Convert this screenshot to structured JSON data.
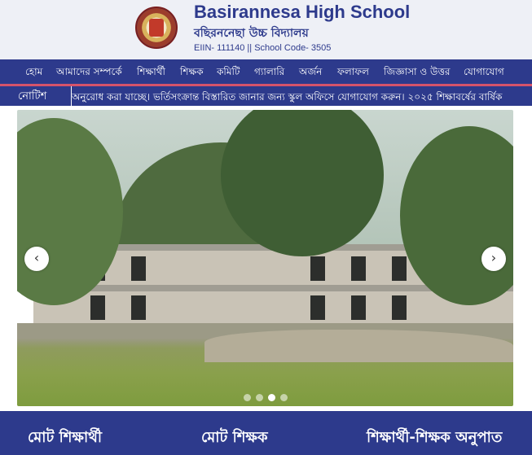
{
  "header": {
    "school_name_en": "Basirannesa High School",
    "school_name_bn": "বছিরননেছা উচ্চ বিদ্যালয়",
    "codes": "EIIN- 111140 || School Code- 3505"
  },
  "nav": {
    "items": [
      {
        "label": "হোম"
      },
      {
        "label": "আমাদের সম্পর্কে"
      },
      {
        "label": "শিক্ষার্থী"
      },
      {
        "label": "শিক্ষক"
      },
      {
        "label": "কমিটি"
      },
      {
        "label": "গ্যালারি"
      },
      {
        "label": "অর্জন"
      },
      {
        "label": "ফলাফল"
      },
      {
        "label": "জিজ্ঞাসা ও উত্তর"
      },
      {
        "label": "যোগাযোগ"
      }
    ]
  },
  "notice": {
    "label": "নোটিশ",
    "ticker": "অনুরোধ করা যাচ্ছে।     ভর্তিসংক্রান্ত বিস্তারিত জানার জন্য স্কুল অফিসে যোগাযোগ করুন।     ২০২৫ শিক্ষাবর্ষের বার্ষিক"
  },
  "slider": {
    "prev_icon": "chevron-left-icon",
    "next_icon": "chevron-right-icon",
    "prev_glyph": "‹",
    "next_glyph": "›",
    "slide_count": 4,
    "active_slide": 3
  },
  "stats": {
    "total_students": "মোট শিক্ষার্থী",
    "total_teachers": "মোট শিক্ষক",
    "ratio": "শিক্ষার্থী-শিক্ষক অনুপাত"
  },
  "colors": {
    "brand": "#2d3a8c",
    "accent": "#d6536b",
    "header_bg": "#eef0f6"
  }
}
